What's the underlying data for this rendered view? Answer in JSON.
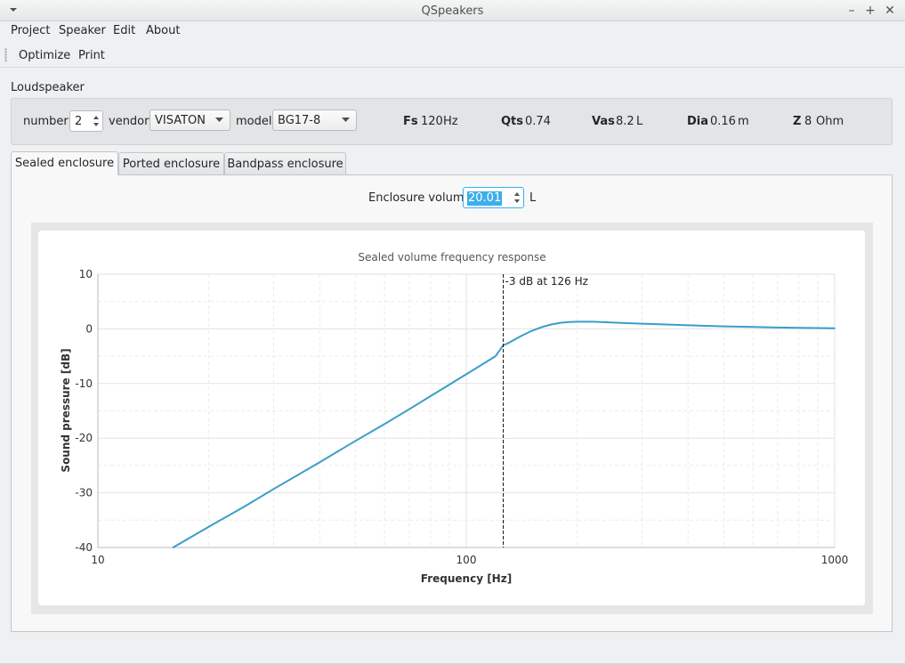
{
  "window": {
    "title": "QSpeakers",
    "minimize": "–",
    "maximize": "+",
    "close": "✕"
  },
  "menu": [
    "Project",
    "Speaker",
    "Edit",
    "About"
  ],
  "toolbar": {
    "optimize": "Optimize",
    "print": "Print"
  },
  "loudspeaker": {
    "group_title": "Loudspeaker",
    "number_label": "number",
    "number_value": "2",
    "vendor_label": "vendor",
    "vendor_value": "VISATON",
    "model_label": "model",
    "model_value": "BG17-8",
    "params": [
      {
        "name": "Fs",
        "value": "120",
        "unit": "Hz"
      },
      {
        "name": "Qts",
        "value": "0.74",
        "unit": ""
      },
      {
        "name": "Vas",
        "value": "8.2",
        "unit": "L"
      },
      {
        "name": "Dia",
        "value": "0.16",
        "unit": "m"
      },
      {
        "name": "Z",
        "value": "8",
        "unit": "Ohm"
      }
    ]
  },
  "tabs": [
    "Sealed enclosure",
    "Ported enclosure",
    "Bandpass enclosure"
  ],
  "active_tab": "Sealed enclosure",
  "enclosure": {
    "label": "Enclosure volume",
    "value": "20.01",
    "unit": "L"
  },
  "chart_data": {
    "type": "line",
    "title": "Sealed volume frequency response",
    "xlabel": "Frequency [Hz]",
    "ylabel": "Sound pressure [dB]",
    "x_scale": "log",
    "xlim": [
      10,
      1000
    ],
    "ylim": [
      -40,
      10
    ],
    "x_ticks": [
      "10",
      "100",
      "1000"
    ],
    "y_ticks": [
      "10",
      "0",
      "-10",
      "-20",
      "-30",
      "-40"
    ],
    "grid": true,
    "series_color": "#3b9dc9",
    "series": [
      {
        "x": [
          16,
          20,
          25,
          30,
          40,
          50,
          60,
          70,
          80,
          90,
          100,
          110,
          120,
          126,
          130,
          140,
          150,
          160,
          170,
          180,
          190,
          200,
          220,
          240,
          260,
          300,
          350,
          400,
          500,
          600,
          700,
          800,
          900,
          1000
        ],
        "y": [
          -40,
          -36.2,
          -32.5,
          -29.3,
          -24.4,
          -20.5,
          -17.4,
          -14.7,
          -12.3,
          -10.2,
          -8.3,
          -6.6,
          -5.0,
          -3.0,
          -2.6,
          -1.4,
          -0.4,
          0.3,
          0.8,
          1.1,
          1.25,
          1.3,
          1.3,
          1.2,
          1.1,
          0.95,
          0.8,
          0.65,
          0.45,
          0.35,
          0.25,
          0.2,
          0.15,
          0.1
        ]
      }
    ],
    "annotation": {
      "x": 126,
      "text": "-3 dB at 126 Hz"
    }
  }
}
